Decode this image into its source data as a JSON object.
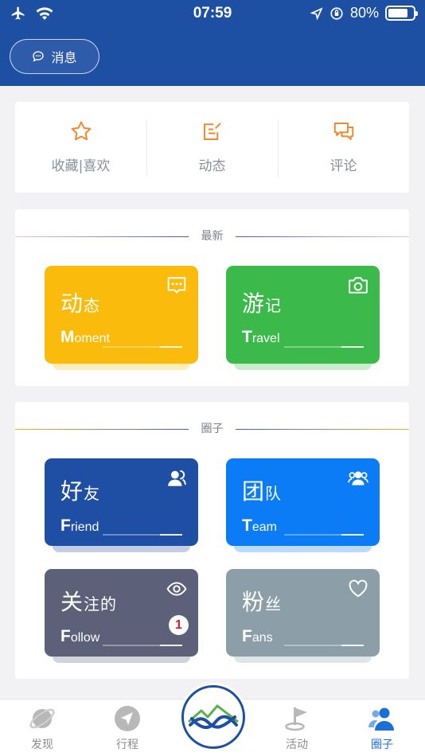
{
  "status": {
    "time": "07:59",
    "battery": "80%",
    "battery_level": 0.8
  },
  "header": {
    "message_label": "消息"
  },
  "quick": [
    {
      "label": "收藏|喜欢",
      "icon": "star-icon"
    },
    {
      "label": "动态",
      "icon": "edit-icon"
    },
    {
      "label": "评论",
      "icon": "comment-icon"
    }
  ],
  "sections": {
    "latest": {
      "title": "最新",
      "tiles": [
        {
          "zh_big": "动",
          "zh_small": "态",
          "en_first": "M",
          "en_rest": "oment",
          "color": "#fbbb0c",
          "icon": "chat-bubble-icon"
        },
        {
          "zh_big": "游",
          "zh_small": "记",
          "en_first": "T",
          "en_rest": "ravel",
          "color": "#3cb94b",
          "icon": "camera-icon"
        }
      ]
    },
    "circle": {
      "title": "圈子",
      "tiles": [
        {
          "zh_big": "好",
          "zh_small": "友",
          "en_first": "F",
          "en_rest": "riend",
          "color": "#1f4ea5",
          "icon": "friend-icon"
        },
        {
          "zh_big": "团",
          "zh_small": "队",
          "en_first": "T",
          "en_rest": "eam",
          "color": "#0c7cf6",
          "icon": "team-icon"
        },
        {
          "zh_big": "关",
          "zh_small": "注的",
          "en_first": "F",
          "en_rest": "ollow",
          "color": "#5c6078",
          "icon": "eye-icon",
          "badge": "1"
        },
        {
          "zh_big": "粉",
          "zh_small": "丝",
          "en_first": "F",
          "en_rest": "ans",
          "color": "#8c9ea8",
          "icon": "heart-icon"
        }
      ]
    }
  },
  "tabbar": {
    "items": [
      {
        "label": "发现",
        "icon": "planet-icon"
      },
      {
        "label": "行程",
        "icon": "navigation-icon"
      },
      {
        "label": "活动",
        "icon": "flag-icon"
      },
      {
        "label": "圈子",
        "icon": "people-icon",
        "active": true
      }
    ]
  }
}
